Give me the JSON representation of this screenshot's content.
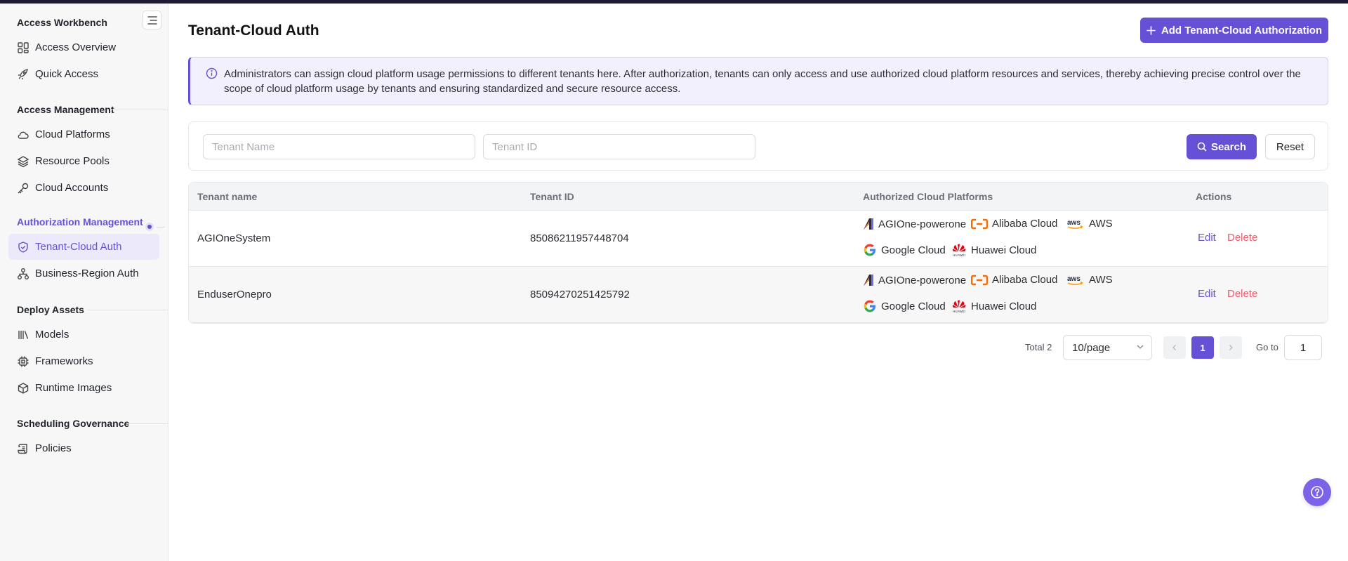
{
  "sidebar": {
    "sections": [
      {
        "title": "Access Workbench",
        "items": [
          {
            "label": "Access Overview",
            "icon": "grid-icon"
          },
          {
            "label": "Quick Access",
            "icon": "rocket-icon"
          }
        ]
      },
      {
        "title": "Access Management",
        "items": [
          {
            "label": "Cloud Platforms",
            "icon": "cloud-icon"
          },
          {
            "label": "Resource Pools",
            "icon": "layers-icon"
          },
          {
            "label": "Cloud Accounts",
            "icon": "key-icon"
          }
        ]
      },
      {
        "title": "Authorization Management",
        "items": [
          {
            "label": "Tenant-Cloud Auth",
            "icon": "shield-check-icon",
            "selected": true
          },
          {
            "label": "Business-Region Auth",
            "icon": "hierarchy-icon"
          }
        ]
      },
      {
        "title": "Deploy Assets",
        "items": [
          {
            "label": "Models",
            "icon": "library-icon"
          },
          {
            "label": "Frameworks",
            "icon": "chip-icon"
          },
          {
            "label": "Runtime Images",
            "icon": "box-icon"
          }
        ]
      },
      {
        "title": "Scheduling Governance",
        "items": [
          {
            "label": "Policies",
            "icon": "scroll-icon"
          }
        ]
      }
    ]
  },
  "header": {
    "title": "Tenant-Cloud Auth",
    "add_button": "Add Tenant-Cloud Authorization"
  },
  "info": {
    "text": "Administrators can assign cloud platform usage permissions to different tenants here. After authorization, tenants can only access and use authorized cloud platform resources and services, thereby achieving precise control over the scope of cloud platform usage by tenants and ensuring standardized and secure resource access."
  },
  "filter": {
    "tenant_name_placeholder": "Tenant Name",
    "tenant_id_placeholder": "Tenant ID",
    "search_label": "Search",
    "reset_label": "Reset"
  },
  "table": {
    "columns": [
      "Tenant name",
      "Tenant ID",
      "Authorized Cloud Platforms",
      "Actions"
    ],
    "rows": [
      {
        "name": "AGIOneSystem",
        "id": "85086211957448704",
        "platforms": [
          "AGIOne-powerone",
          "Alibaba Cloud",
          "AWS",
          "Google Cloud",
          "Huawei Cloud"
        ],
        "edit": "Edit",
        "delete": "Delete"
      },
      {
        "name": "EnduserOnepro",
        "id": "85094270251425792",
        "platforms": [
          "AGIOne-powerone",
          "Alibaba Cloud",
          "AWS",
          "Google Cloud",
          "Huawei Cloud"
        ],
        "edit": "Edit",
        "delete": "Delete"
      }
    ]
  },
  "pagination": {
    "total": "Total 2",
    "page_size": "10/page",
    "current_page": "1",
    "goto_label": "Go to",
    "goto_value": "1"
  },
  "colors": {
    "accent": "#6651d6",
    "danger": "#ef5a6b"
  }
}
